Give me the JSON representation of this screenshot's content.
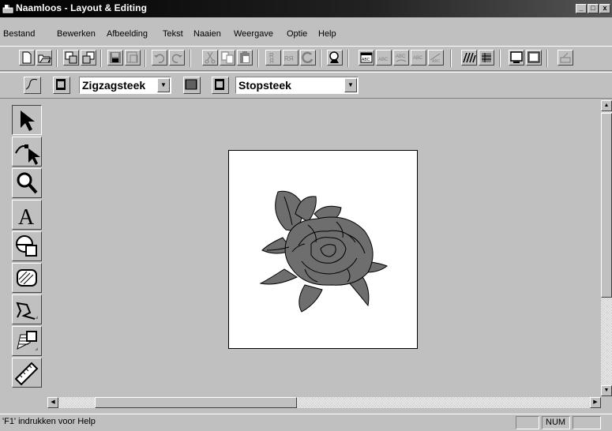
{
  "window": {
    "title": "Naamloos - Layout & Editing",
    "minimize_glyph": "_",
    "restore_glyph": "□",
    "close_glyph": "x"
  },
  "menu": [
    {
      "label": "Bestand"
    },
    {
      "label": "Bewerken"
    },
    {
      "label": "Afbeelding"
    },
    {
      "label": "Tekst"
    },
    {
      "label": "Naaien"
    },
    {
      "label": "Weergave"
    },
    {
      "label": "Optie"
    },
    {
      "label": "Help"
    }
  ],
  "toolbar2": {
    "stitch1": "Zigzagsteek",
    "stitch2": "Stopsteek"
  },
  "toolbox": {
    "tools": [
      "select-arrow-icon",
      "point-edit-icon",
      "zoom-icon",
      "text-icon",
      "shape-icon",
      "fill-pattern-icon",
      "manual-punch-icon",
      "stitch-repeat-icon",
      "ruler-icon"
    ]
  },
  "status": {
    "help_text": "'F1' indrukken voor Help",
    "num": "NUM"
  },
  "colors": {
    "face": "#c0c0c0",
    "rose_fill": "#6e6e6e",
    "canvas": "#ffffff"
  }
}
